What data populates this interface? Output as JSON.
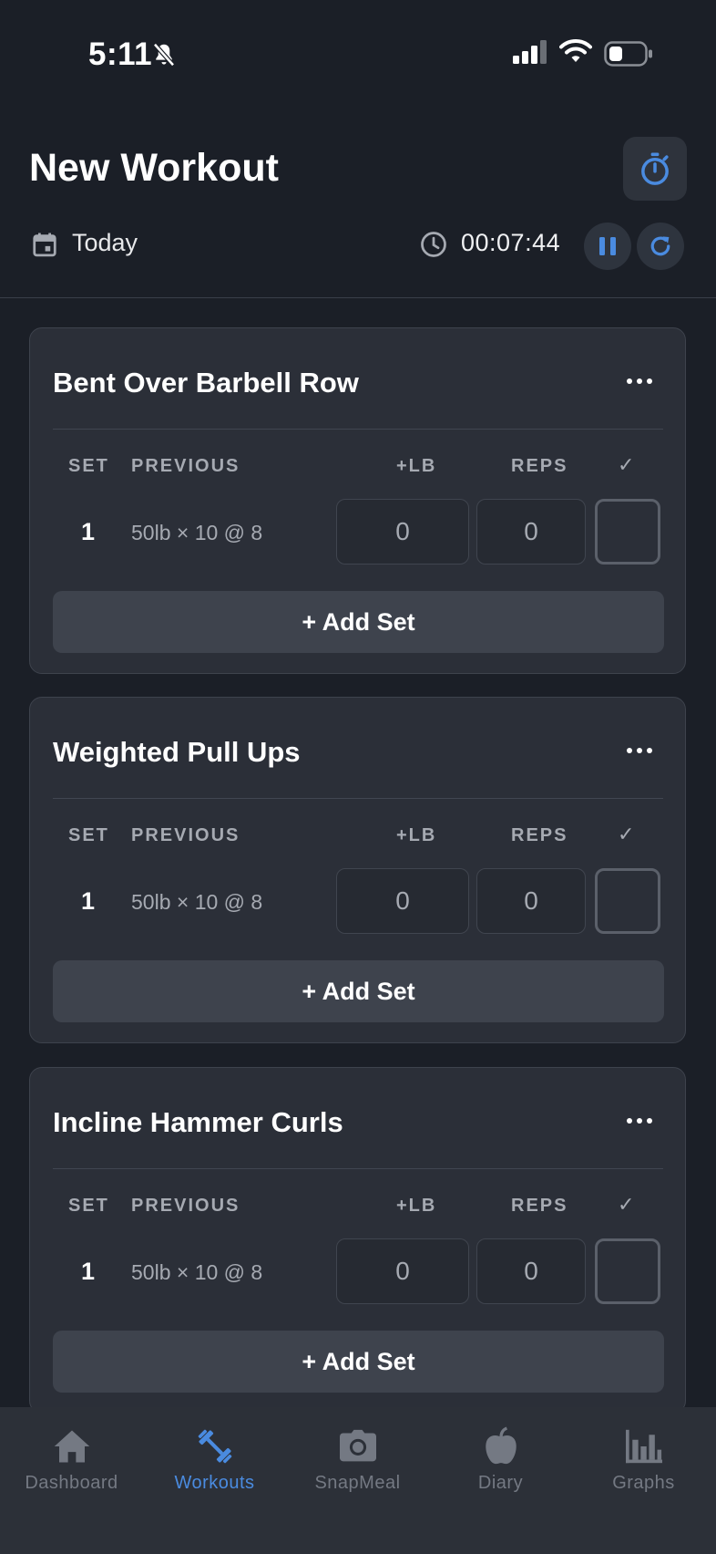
{
  "status_bar": {
    "time": "5:11"
  },
  "header": {
    "title": "New Workout",
    "date_label": "Today",
    "elapsed_time": "00:07:44"
  },
  "columns": {
    "set": "SET",
    "previous": "PREVIOUS",
    "weight": "+LB",
    "reps": "REPS",
    "done": "✓"
  },
  "exercises": [
    {
      "name": "Bent Over Barbell Row",
      "set": "1",
      "previous": "50lb × 10 @ 8",
      "weight": "0",
      "reps": "0",
      "add_label": "+ Add Set"
    },
    {
      "name": "Weighted Pull Ups",
      "set": "1",
      "previous": "50lb × 10 @ 8",
      "weight": "0",
      "reps": "0",
      "add_label": "+ Add Set"
    },
    {
      "name": "Incline Hammer Curls",
      "set": "1",
      "previous": "50lb × 10 @ 8",
      "weight": "0",
      "reps": "0",
      "add_label": "+ Add Set"
    }
  ],
  "tabs": [
    {
      "label": "Dashboard",
      "icon": "home-icon"
    },
    {
      "label": "Workouts",
      "icon": "dumbbell-icon",
      "active": true
    },
    {
      "label": "SnapMeal",
      "icon": "camera-icon"
    },
    {
      "label": "Diary",
      "icon": "apple-icon"
    },
    {
      "label": "Graphs",
      "icon": "bar-chart-icon"
    }
  ],
  "colors": {
    "background": "#1b1f27",
    "card": "#2b2f38",
    "accent": "#4a8be0",
    "muted": "#a6aab2"
  }
}
